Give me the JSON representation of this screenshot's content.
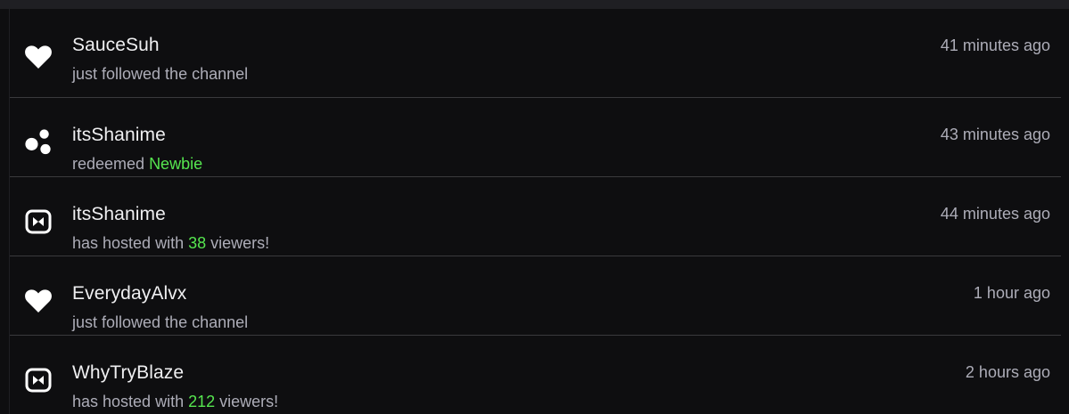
{
  "events": [
    {
      "icon": "heart-icon",
      "user": "SauceSuh",
      "detail_pre": "just followed the channel",
      "highlight": "",
      "detail_post": "",
      "time": "41 minutes ago"
    },
    {
      "icon": "channel-points-icon",
      "user": "itsShanime",
      "detail_pre": "redeemed ",
      "highlight": "Newbie",
      "detail_post": "",
      "time": "43 minutes ago"
    },
    {
      "icon": "host-icon",
      "user": "itsShanime",
      "detail_pre": "has hosted with ",
      "highlight": "38",
      "detail_post": " viewers!",
      "time": "44 minutes ago"
    },
    {
      "icon": "heart-icon",
      "user": "EverydayAlvx",
      "detail_pre": "just followed the channel",
      "highlight": "",
      "detail_post": "",
      "time": "1 hour ago"
    },
    {
      "icon": "host-icon",
      "user": "WhyTryBlaze",
      "detail_pre": "has hosted with ",
      "highlight": "212",
      "detail_post": " viewers!",
      "time": "2 hours ago"
    }
  ],
  "colors": {
    "background": "#0e0e10",
    "text": "#efeff1",
    "muted": "#adadb8",
    "highlight": "#56e64f",
    "divider": "#3a3a3d"
  }
}
